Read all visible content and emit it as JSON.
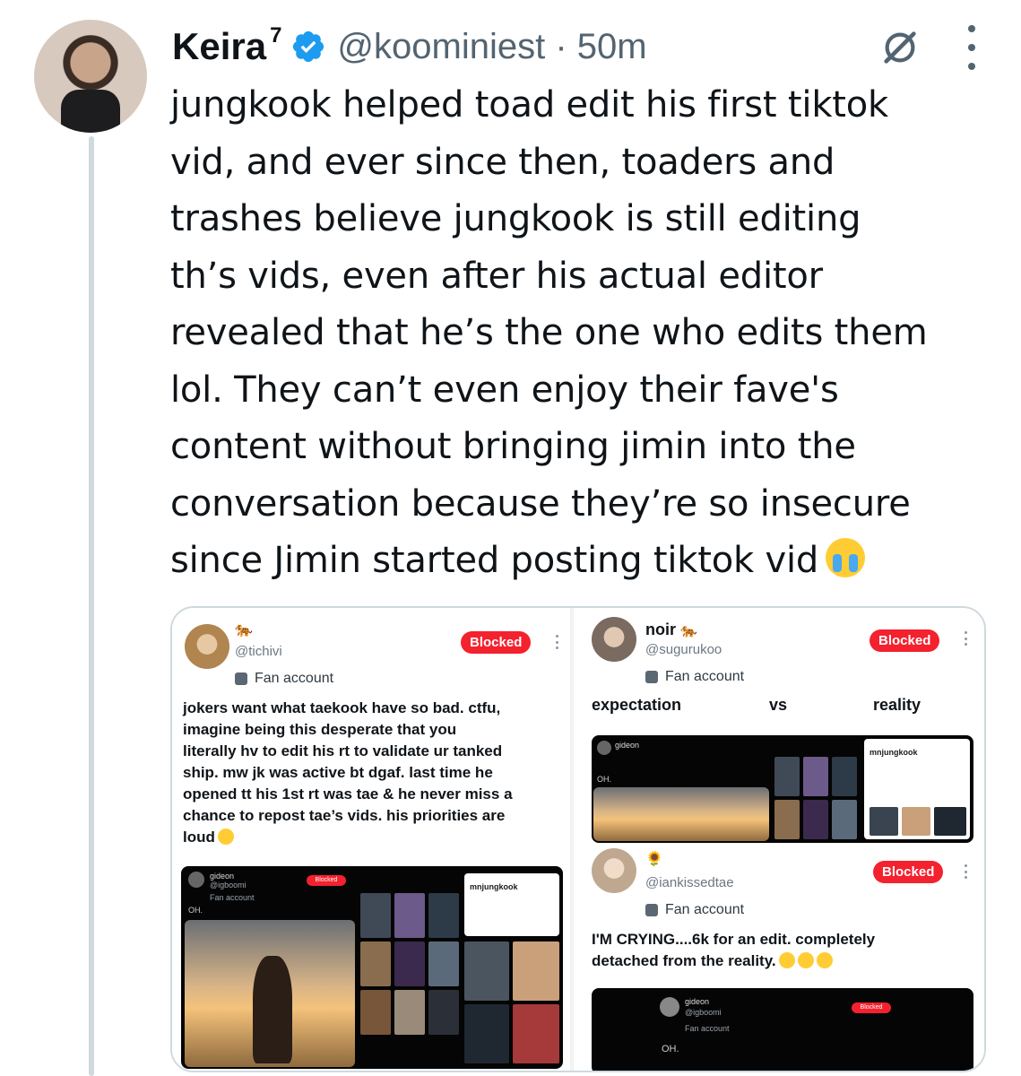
{
  "tweet": {
    "author_name": "Keira",
    "author_sup": "7",
    "handle": "@koominiest",
    "separator": "·",
    "time": "50m",
    "text": "jungkook helped toad edit his first tiktok\nvid, and ever since then, toaders and\ntrashes believe jungkook is still editing\nth’s vids, even after his actual editor\nrevealed that he’s the one who edits them\nlol. They can’t even enjoy their fave's\ncontent without bringing jimin into the\nconversation because they’re so insecure\nsince Jimin started posting tiktok vid",
    "text_emoji": "loudly-crying-face"
  },
  "icons": {
    "verified": "verified-badge-icon",
    "grok": "grok-icon",
    "more": "more-options-icon"
  },
  "colors": {
    "verified": "#1d9bf0",
    "blocked": "#f4212e",
    "secondary_text": "#536471",
    "thread_line": "#cfd9de"
  },
  "media": {
    "left": {
      "badge_emoji": "🐅",
      "handle": "@tichivi",
      "blocked_label": "Blocked",
      "fan_label": "Fan account",
      "text": "jokers want what taekook have so bad. ctfu,\nimagine being this desperate that you\nliterally hv to edit his rt to validate ur tanked\nship. mw jk was active bt dgaf. last time he\nopened tt his 1st rt was tae & he never miss a\nchance to repost tae’s vids. his priorities are\nloud",
      "inner_shot": {
        "name": "gideon",
        "handle": "@igboomi",
        "fan": "Fan account",
        "blocked": "Blocked",
        "caption": "OH.",
        "profile_name": "mnjungkook"
      }
    },
    "right": {
      "name": "noir",
      "badge_emoji": "🐅",
      "handle": "@sugurukoo",
      "blocked_label": "Blocked",
      "fan_label": "Fan account",
      "expectation": "expectation",
      "vs": "vs",
      "reality": "reality",
      "inner_shot": {
        "name": "gideon",
        "caption": "OH.",
        "profile_name": "mnjungkook"
      },
      "reply": {
        "badge_emoji": "🌻",
        "handle": "@iankissedtae",
        "blocked_label": "Blocked",
        "fan_label": "Fan account",
        "text": "I'M CRYING....6k for an edit. completely\ndetached from the reality.",
        "inner_shot": {
          "name": "gideon",
          "handle": "@igboomi",
          "fan": "Fan account",
          "blocked": "Blocked",
          "caption": "OH."
        }
      }
    }
  }
}
